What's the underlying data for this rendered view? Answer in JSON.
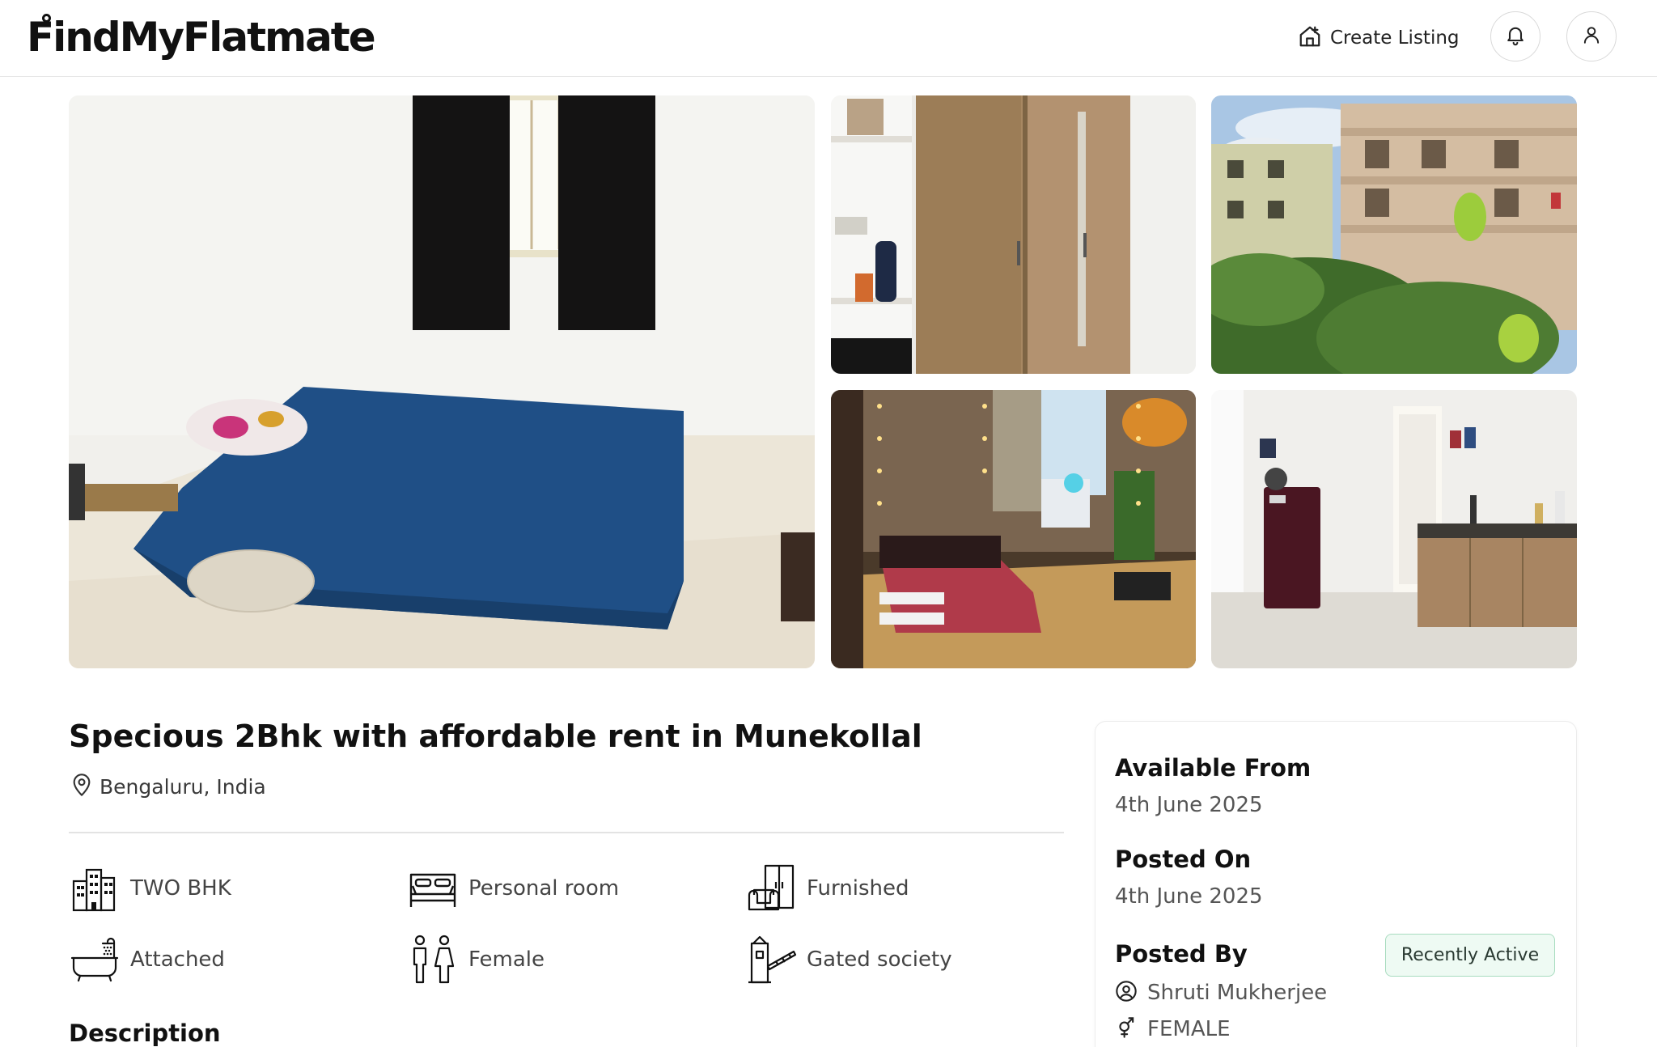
{
  "header": {
    "logo_text": "FindMyFlatmate",
    "create_listing_label": "Create Listing",
    "icons": [
      "home-plus-icon",
      "bell-icon",
      "user-icon"
    ]
  },
  "gallery": {
    "photos": [
      "bedroom-with-blue-mattress",
      "wardrobe-and-shelf",
      "balcony-view-of-building",
      "decorated-bedroom-with-lights",
      "kitchen-with-fridge"
    ]
  },
  "listing": {
    "title": "Specious 2Bhk with affordable rent in Munekollal",
    "location": "Bengaluru, India",
    "features": [
      {
        "icon": "building-icon",
        "label": "TWO BHK"
      },
      {
        "icon": "bed-icon",
        "label": "Personal room"
      },
      {
        "icon": "furniture-icon",
        "label": "Furnished"
      },
      {
        "icon": "bathtub-icon",
        "label": "Attached"
      },
      {
        "icon": "male-female-icon",
        "label": "Female"
      },
      {
        "icon": "gate-icon",
        "label": "Gated society"
      }
    ],
    "description_heading": "Description"
  },
  "side_card": {
    "available_from_label": "Available From",
    "available_from_value": "4th June 2025",
    "posted_on_label": "Posted On",
    "posted_on_value": "4th June 2025",
    "posted_by_label": "Posted By",
    "status_badge": "Recently Active",
    "poster_name": "Shruti Mukherjee",
    "poster_gender": "FEMALE"
  },
  "colors": {
    "badge_bg": "#eefaf3",
    "badge_border": "#a8dcbf",
    "text_primary": "#111111",
    "text_secondary": "#555555"
  }
}
